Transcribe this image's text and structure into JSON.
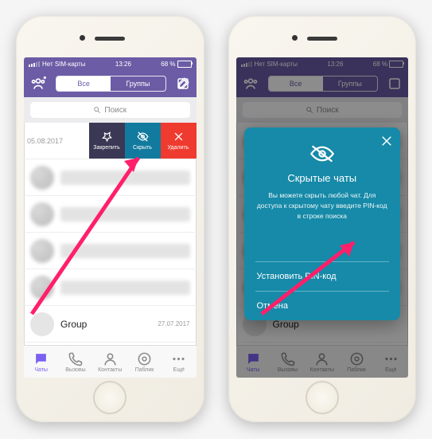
{
  "status": {
    "carrier": "Нет SIM-карты",
    "time": "13:26",
    "battery": "68 %"
  },
  "header": {
    "seg_all": "Все",
    "seg_groups": "Группы"
  },
  "search": {
    "placeholder": "Поиск"
  },
  "swiped_row": {
    "date": "05.08.2017",
    "pin": "Закрепить",
    "hide": "Скрыть",
    "delete": "Удалить"
  },
  "last_row": {
    "name": "Group",
    "date": "27.07.2017"
  },
  "tabs": {
    "chats": "Чаты",
    "calls": "Вызовы",
    "contacts": "Контакты",
    "public": "Паблик",
    "more": "Ещё"
  },
  "modal": {
    "title": "Скрытые чаты",
    "body": "Вы можете скрыть любой чат. Для доступа к скрытому чату введите PIN-код в строке поиска",
    "set_pin": "Установить PIN-код",
    "cancel": "Отмена"
  }
}
